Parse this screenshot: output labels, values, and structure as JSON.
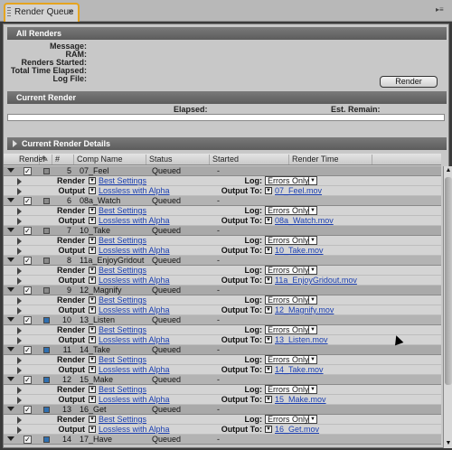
{
  "tab": {
    "title": "Render Queue",
    "close": "×"
  },
  "all_renders": {
    "title": "All Renders",
    "labels": [
      "Message:",
      "RAM:",
      "Renders Started:",
      "Total Time Elapsed:",
      "Log File:"
    ],
    "render_button": "Render"
  },
  "current_render": {
    "title": "Current Render",
    "elapsed_label": "Elapsed:",
    "est_remain_label": "Est. Remain:"
  },
  "details": {
    "title": "Current Render Details"
  },
  "columns": [
    "Render",
    "#",
    "Comp Name",
    "Status",
    "Started",
    "Render Time"
  ],
  "sub_labels": {
    "render_settings": "Render Settings:",
    "output_module": "Output Module:",
    "log": "Log:",
    "output_to": "Output To:"
  },
  "colors": {
    "accent_tab_border": "#e5a41f",
    "link": "#1b3fb0",
    "label_blue": "#2f6fb0",
    "label_gray": "#8a8a8a"
  },
  "items": [
    {
      "num": "5",
      "comp": "07_Feel",
      "status": "Queued",
      "started": "-",
      "label_color": "#8a8a8a",
      "render_settings": "Best Settings",
      "output_module": "Lossless with Alpha",
      "log": "Errors Only",
      "output_to": "07_Feel.mov"
    },
    {
      "num": "6",
      "comp": "08a_Watch",
      "status": "Queued",
      "started": "-",
      "label_color": "#8a8a8a",
      "render_settings": "Best Settings",
      "output_module": "Lossless with Alpha",
      "log": "Errors Only",
      "output_to": "08a_Watch.mov"
    },
    {
      "num": "7",
      "comp": "10_Take",
      "status": "Queued",
      "started": "-",
      "label_color": "#8a8a8a",
      "render_settings": "Best Settings",
      "output_module": "Lossless with Alpha",
      "log": "Errors Only",
      "output_to": "10_Take.mov"
    },
    {
      "num": "8",
      "comp": "11a_EnjoyGridout",
      "status": "Queued",
      "started": "-",
      "label_color": "#8a8a8a",
      "render_settings": "Best Settings",
      "output_module": "Lossless with Alpha",
      "log": "Errors Only",
      "output_to": "11a_EnjoyGridout.mov"
    },
    {
      "num": "9",
      "comp": "12_Magnify",
      "status": "Queued",
      "started": "-",
      "label_color": "#8a8a8a",
      "render_settings": "Best Settings",
      "output_module": "Lossless with Alpha",
      "log": "Errors Only",
      "output_to": "12_Magnify.mov"
    },
    {
      "num": "10",
      "comp": "13_Listen",
      "status": "Queued",
      "started": "-",
      "label_color": "#2f6fb0",
      "render_settings": "Best Settings",
      "output_module": "Lossless with Alpha",
      "log": "Errors Only",
      "output_to": "13_Listen.mov"
    },
    {
      "num": "11",
      "comp": "14_Take",
      "status": "Queued",
      "started": "-",
      "label_color": "#2f6fb0",
      "render_settings": "Best Settings",
      "output_module": "Lossless with Alpha",
      "log": "Errors Only",
      "output_to": "14_Take.mov"
    },
    {
      "num": "12",
      "comp": "15_Make",
      "status": "Queued",
      "started": "-",
      "label_color": "#2f6fb0",
      "render_settings": "Best Settings",
      "output_module": "Lossless with Alpha",
      "log": "Errors Only",
      "output_to": "15_Make.mov"
    },
    {
      "num": "13",
      "comp": "16_Get",
      "status": "Queued",
      "started": "-",
      "label_color": "#2f6fb0",
      "render_settings": "Best Settings",
      "output_module": "Lossless with Alpha",
      "log": "Errors Only",
      "output_to": "16_Get.mov"
    },
    {
      "num": "14",
      "comp": "17_Have",
      "status": "Queued",
      "started": "-",
      "label_color": "#2f6fb0"
    }
  ]
}
